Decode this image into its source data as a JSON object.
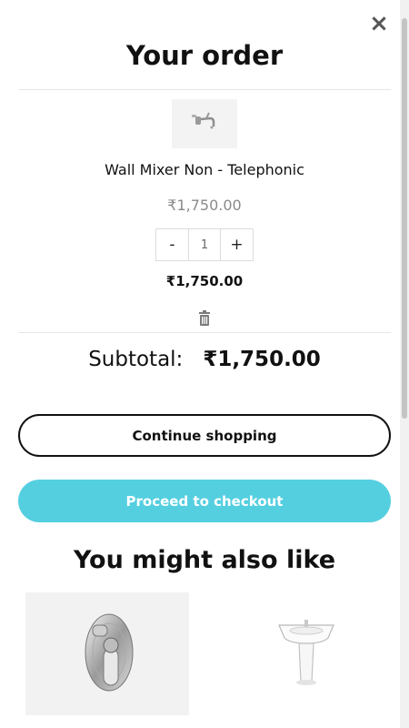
{
  "window": {
    "close_label": "×"
  },
  "order": {
    "title": "Your order",
    "item": {
      "name": "Wall Mixer Non - Telephonic",
      "unit_price": "₹1,750.00",
      "quantity": "1",
      "decrement_label": "-",
      "increment_label": "+",
      "line_total": "₹1,750.00",
      "thumbnail_icon": "faucet-icon",
      "delete_icon": "trash-icon"
    },
    "subtotal": {
      "label": "Subtotal:",
      "amount": "₹1,750.00"
    }
  },
  "actions": {
    "continue_label": "Continue shopping",
    "checkout_label": "Proceed to checkout"
  },
  "recommendations": {
    "title": "You might also like",
    "products": [
      {
        "icon": "diverter-valve-icon"
      },
      {
        "icon": "pedestal-basin-icon"
      }
    ]
  },
  "colors": {
    "accent": "#54cfe0",
    "text": "#111111",
    "muted": "#8a8a8a"
  }
}
